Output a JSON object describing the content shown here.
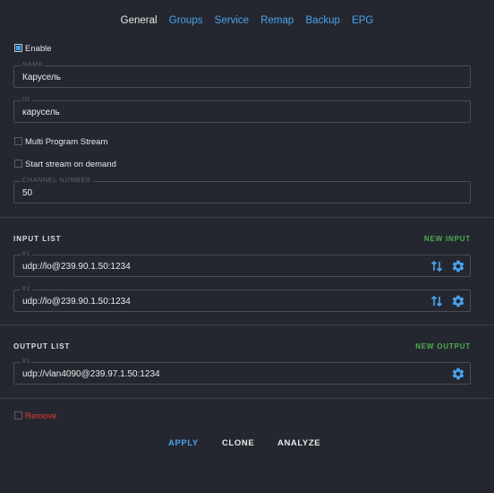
{
  "tabs": [
    {
      "label": "General",
      "active": true
    },
    {
      "label": "Groups"
    },
    {
      "label": "Service"
    },
    {
      "label": "Remap"
    },
    {
      "label": "Backup"
    },
    {
      "label": "EPG"
    }
  ],
  "enable": {
    "label": "Enable",
    "checked": true
  },
  "name_field": {
    "label": "NAME",
    "value": "Карусель"
  },
  "id_field": {
    "label": "ID",
    "value": "карусель"
  },
  "multi_program": {
    "label": "Multi Program Stream",
    "checked": false
  },
  "start_on_demand": {
    "label": "Start stream on demand",
    "checked": false
  },
  "channel_number": {
    "label": "CHANNEL NUMBER",
    "value": "50"
  },
  "input_list": {
    "title": "INPUT LIST",
    "new_label": "NEW INPUT",
    "items": [
      {
        "label": "#1",
        "value": "udp://lo@239.90.1.50:1234"
      },
      {
        "label": "#2",
        "value": "udp://lo@239.90.1.50:1234"
      }
    ]
  },
  "output_list": {
    "title": "OUTPUT LIST",
    "new_label": "NEW OUTPUT",
    "items": [
      {
        "label": "#1",
        "value": "udp://vlan4090@239.97.1.50:1234"
      }
    ]
  },
  "remove": {
    "label": "Remove",
    "checked": false
  },
  "footer": {
    "apply": "APPLY",
    "clone": "CLONE",
    "analyze": "ANALYZE"
  },
  "colors": {
    "background": "#252730",
    "accent_blue": "#4aa3ec",
    "accent_green": "#4caf50",
    "danger_red": "#e53935"
  }
}
